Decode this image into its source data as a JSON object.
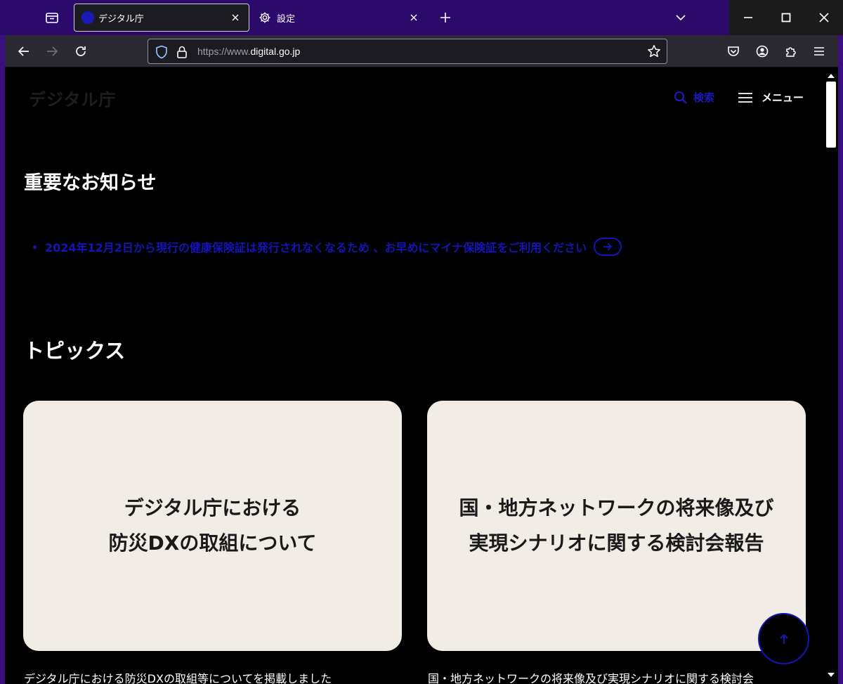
{
  "browser": {
    "tabs": [
      {
        "title": "デジタル庁",
        "active": true
      },
      {
        "title": "設定",
        "active": false
      }
    ],
    "url_prefix": "https://www.",
    "url_domain": "digital.go.jp",
    "icons": {
      "tab_list": "tab-list-icon",
      "new_tab": "plus-icon",
      "tabs_overflow": "chevron-down-icon",
      "back": "arrow-left-icon",
      "forward": "arrow-right-icon",
      "reload": "reload-icon",
      "shield": "shield-icon",
      "lock": "lock-icon",
      "bookmark": "star-icon",
      "pocket": "pocket-icon",
      "account": "account-icon",
      "extensions": "puzzle-icon",
      "app_menu": "hamburger-icon"
    }
  },
  "site": {
    "logo": "デジタル庁",
    "search_label": "検索",
    "menu_label": "メニュー"
  },
  "important": {
    "heading": "重要なお知らせ",
    "items": [
      {
        "text": "2024年12月2日から現行の健康保険証は発行されなくなるため 、お早めにマイナ保険証をご利用ください"
      }
    ]
  },
  "topics": {
    "heading": "トピックス",
    "cards": [
      {
        "line1": "デジタル庁における",
        "line2": "防災DXの取組について",
        "caption": "デジタル庁における防災DXの取組等についてを掲載しました"
      },
      {
        "line1": "国・地方ネットワークの将来像及び",
        "line2": "実現シナリオに関する検討会報告",
        "caption": "国・地方ネットワークの将来像及び実現シナリオに関する検討会"
      }
    ]
  },
  "colors": {
    "frame": "#3b0f80",
    "accent_blue": "#1414b8",
    "card_bg": "#f1ede6"
  }
}
